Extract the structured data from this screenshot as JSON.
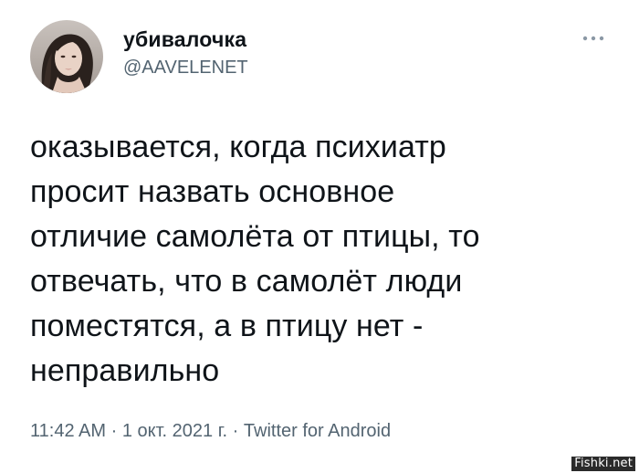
{
  "user": {
    "display_name": "убивалочка",
    "handle": "@AAVELENET",
    "avatar_icon": "user-avatar-photo"
  },
  "menu": {
    "more_icon": "more-horizontal-icon"
  },
  "tweet": {
    "lines": [
      "оказывается, когда психиатр",
      "просит назвать основное",
      "отличие самолёта от птицы, то",
      "отвечать, что в самолёт люди",
      "поместятся, а в птицу нет -",
      "неправильно"
    ]
  },
  "meta": {
    "time": "11:42 AM",
    "sep1": " · ",
    "date": "1 окт. 2021 г.",
    "sep2": " · ",
    "source": "Twitter for Android"
  },
  "watermark": {
    "text": "Fishki.net"
  },
  "colors": {
    "text_primary": "#0f1419",
    "text_secondary": "#536471",
    "background": "#ffffff"
  }
}
